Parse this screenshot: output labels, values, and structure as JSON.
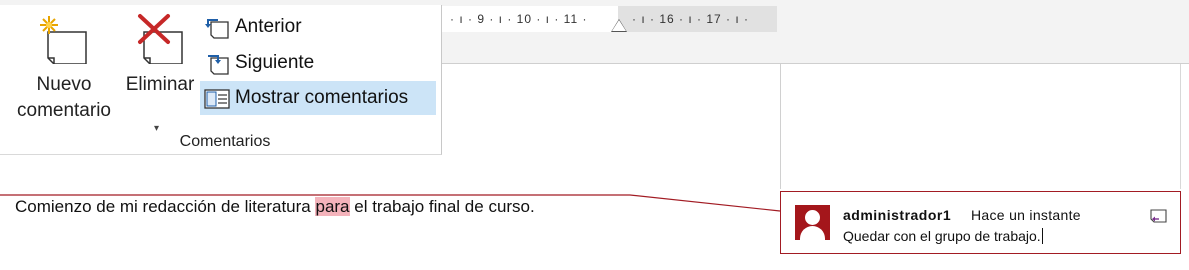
{
  "ruler": {
    "text": "· ı · 9 · ı · 10 · ı · 11 · △ · ı · 16 · ı · 17 · ı ·",
    "ticks_left": "· ı · 9 · ı · 10 · ı · 11 ·",
    "ticks_right": "· ı · 16 · ı · 17 · ı ·"
  },
  "ribbon": {
    "new_comment_label_1": "Nuevo",
    "new_comment_label_2": "comentario",
    "delete_label": "Eliminar",
    "dropdown_glyph": "▾",
    "previous_label": "Anterior",
    "next_label": "Siguiente",
    "show_comments_label": "Mostrar comentarios",
    "group_label": "Comentarios"
  },
  "document": {
    "text_before": "Comienzo de mi redacción de literatura ",
    "highlighted": "para",
    "text_after": " el trabajo final de curso."
  },
  "comment": {
    "author": "administrador1",
    "time": "Hace un instante",
    "text": "Quedar con el grupo de trabajo."
  },
  "colors": {
    "comment_accent": "#a21b23",
    "highlight": "#f4b3bb",
    "selected_button": "#cce4f7"
  },
  "icons": {
    "new_comment": "new-comment-icon",
    "delete_comment": "delete-comment-icon",
    "previous": "previous-comment-icon",
    "next": "next-comment-icon",
    "show_comments": "show-comments-icon",
    "avatar": "user-avatar-icon",
    "reply": "reply-icon"
  }
}
